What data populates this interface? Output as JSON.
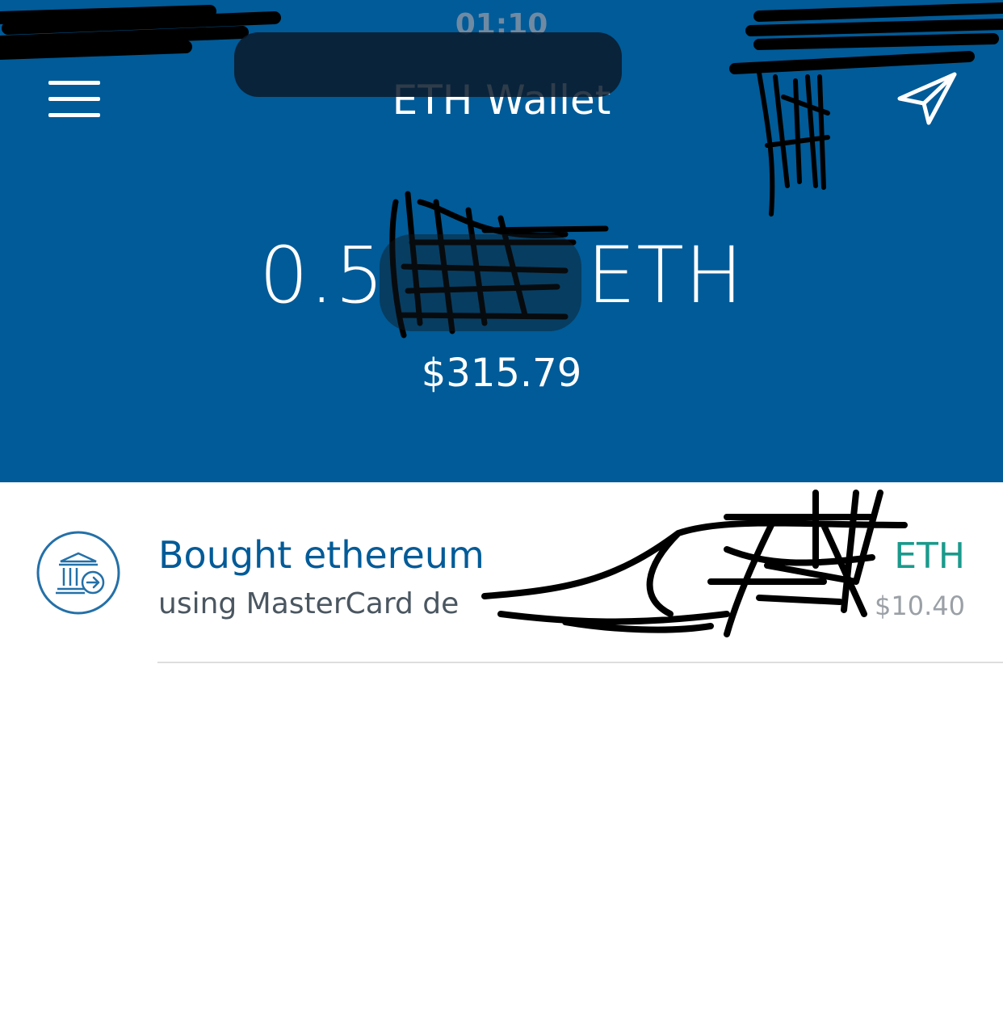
{
  "status_bar": {
    "time": "01:10"
  },
  "nav": {
    "title": "ETH Wallet",
    "menu_icon": "hamburger-menu-icon",
    "send_icon": "paper-plane-icon"
  },
  "balance": {
    "crypto": "0.5",
    "crypto_unit": "ETH",
    "fiat": "$315.79"
  },
  "transactions": [
    {
      "icon": "bank-transfer-icon",
      "title": "Bought ethereum",
      "subtitle": "using MasterCard de",
      "amount_unit": "ETH",
      "fiat": "$10.40"
    }
  ],
  "colors": {
    "header_bg": "#005b98",
    "title_text": "#005b98",
    "amount_text": "#1a9a8c",
    "subtitle_text": "#4a5660",
    "fiat_text": "#9aa0a6"
  }
}
